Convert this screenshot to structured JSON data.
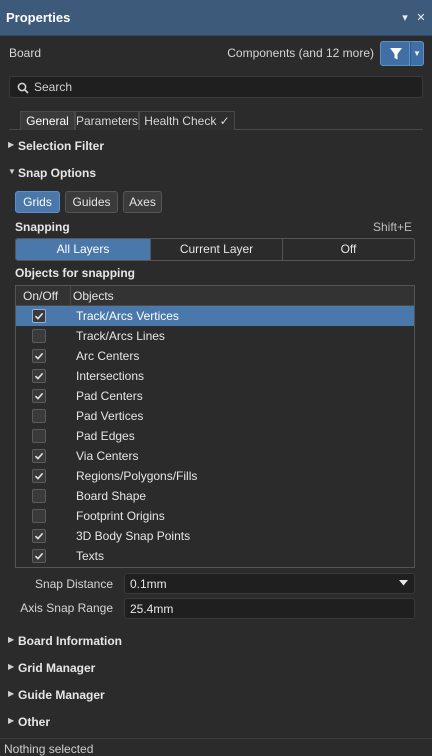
{
  "panel": {
    "title": "Properties",
    "pin_icon": "pin-down-icon",
    "close_icon": "close-icon"
  },
  "header": {
    "object_type": "Board",
    "filter_summary": "Components (and 12 more)",
    "filter_icon": "filter-icon"
  },
  "search": {
    "placeholder": "Search",
    "value": ""
  },
  "tabs": [
    {
      "label": "General",
      "active": true
    },
    {
      "label": "Parameters",
      "active": false
    },
    {
      "label": "Health Check ✓",
      "active": false
    }
  ],
  "sections": {
    "selection_filter": "Selection Filter",
    "snap_options": "Snap Options",
    "board_information": "Board Information",
    "grid_manager": "Grid Manager",
    "guide_manager": "Guide Manager",
    "other": "Other"
  },
  "snap_options": {
    "mode_buttons": [
      {
        "label": "Grids",
        "active": true
      },
      {
        "label": "Guides",
        "active": false
      },
      {
        "label": "Axes",
        "active": false
      }
    ],
    "snapping_label": "Snapping",
    "snapping_shortcut": "Shift+E",
    "layer_options": [
      {
        "label": "All Layers",
        "active": true
      },
      {
        "label": "Current Layer",
        "active": false
      },
      {
        "label": "Off",
        "active": false
      }
    ],
    "objects_label": "Objects for snapping",
    "table": {
      "col_onoff": "On/Off",
      "col_objects": "Objects",
      "rows": [
        {
          "name": "Track/Arcs Vertices",
          "checked": true,
          "selected": true
        },
        {
          "name": "Track/Arcs Lines",
          "checked": false,
          "selected": false
        },
        {
          "name": "Arc Centers",
          "checked": true,
          "selected": false
        },
        {
          "name": "Intersections",
          "checked": true,
          "selected": false
        },
        {
          "name": "Pad Centers",
          "checked": true,
          "selected": false
        },
        {
          "name": "Pad Vertices",
          "checked": false,
          "selected": false
        },
        {
          "name": "Pad Edges",
          "checked": false,
          "selected": false
        },
        {
          "name": "Via Centers",
          "checked": true,
          "selected": false
        },
        {
          "name": "Regions/Polygons/Fills",
          "checked": true,
          "selected": false
        },
        {
          "name": "Board Shape",
          "checked": false,
          "selected": false
        },
        {
          "name": "Footprint Origins",
          "checked": false,
          "selected": false
        },
        {
          "name": "3D Body Snap Points",
          "checked": true,
          "selected": false
        },
        {
          "name": "Texts",
          "checked": true,
          "selected": false
        }
      ]
    },
    "snap_distance_label": "Snap Distance",
    "snap_distance_value": "0.1mm",
    "axis_snap_range_label": "Axis Snap Range",
    "axis_snap_range_value": "25.4mm"
  },
  "status": {
    "text": "Nothing selected"
  },
  "colors": {
    "titlebar": "#3e5a7a",
    "accent": "#4a78ab",
    "background": "#2b2b2b"
  }
}
